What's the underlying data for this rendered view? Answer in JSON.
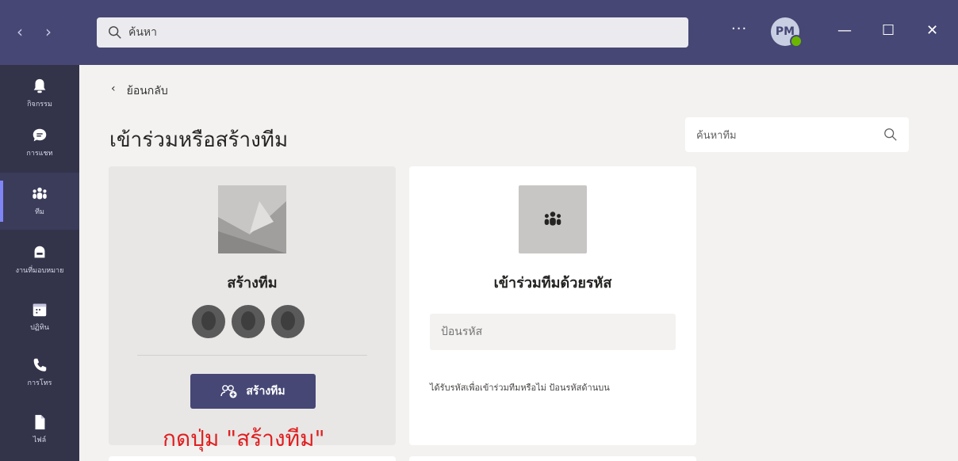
{
  "titlebar": {
    "search_placeholder": "ค้นหา",
    "more_label": "···",
    "avatar_initials": "PM"
  },
  "rail": {
    "items": [
      {
        "label": "กิจกรรม",
        "icon": "bell-icon"
      },
      {
        "label": "การแชท",
        "icon": "chat-icon"
      },
      {
        "label": "ทีม",
        "icon": "teams-icon",
        "active": true
      },
      {
        "label": "งานที่มอบหมาย",
        "icon": "assignments-icon"
      },
      {
        "label": "ปฏิทิน",
        "icon": "calendar-icon"
      },
      {
        "label": "การโทร",
        "icon": "phone-icon"
      },
      {
        "label": "ไฟล์",
        "icon": "file-icon"
      }
    ]
  },
  "main": {
    "back_label": "ย้อนกลับ",
    "page_title": "เข้าร่วมหรือสร้างทีม",
    "team_search_placeholder": "ค้นหาทีม"
  },
  "create_card": {
    "title": "สร้างทีม",
    "button_label": "สร้างทีม"
  },
  "join_card": {
    "title": "เข้าร่วมทีมด้วยรหัส",
    "code_placeholder": "ป้อนรหัส",
    "hint": "ได้รับรหัสเพื่อเข้าร่วมทีมหรือไม่ ป้อนรหัสด้านบน"
  },
  "annotation": "กดปุ่ม \"สร้างทีม\"",
  "colors": {
    "accent": "#464775",
    "rail": "#33344a",
    "annotation": "#e02020"
  }
}
